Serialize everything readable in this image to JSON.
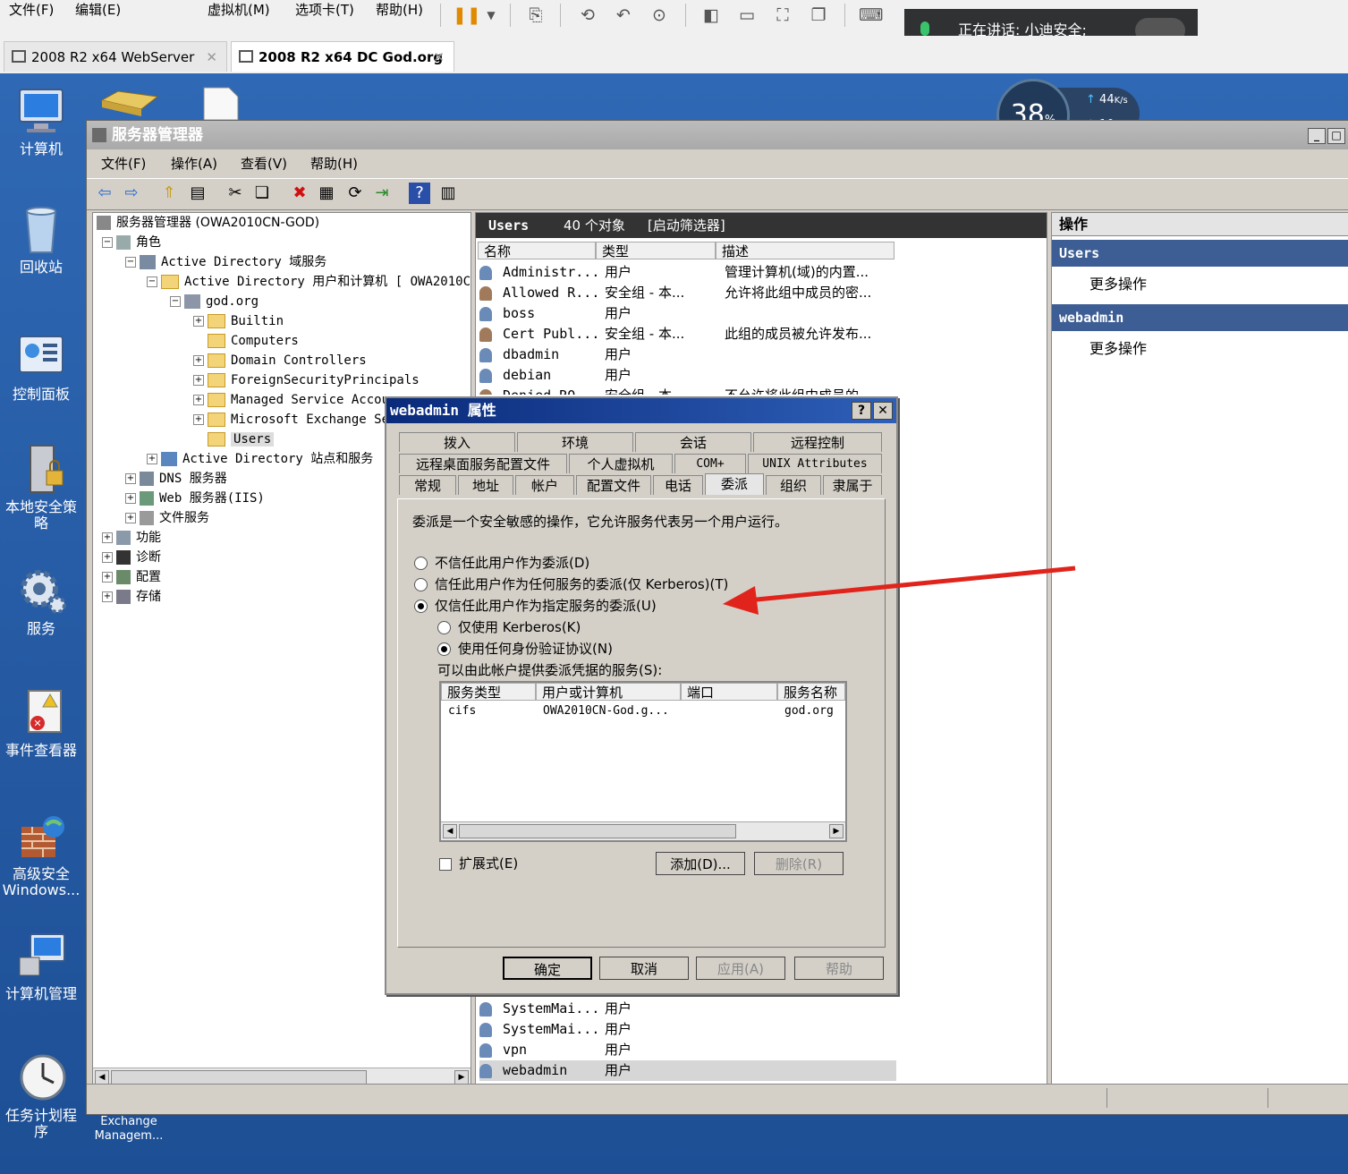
{
  "host": {
    "menus": [
      "文件(F)",
      "编辑(E)",
      "虚拟机(M)",
      "选项卡(T)",
      "帮助(H)"
    ],
    "tabs": [
      {
        "label": "2008 R2 x64 WebServer",
        "active": false
      },
      {
        "label": "2008 R2 x64 DC God.org",
        "active": true
      }
    ],
    "recording_text": "正在讲话: 小迪安全;"
  },
  "desktop": {
    "icons": [
      "计算机",
      "回收站",
      "控制面板",
      "本地安全策略",
      "服务",
      "事件查看器",
      "高级安全 Windows...",
      "计算机管理",
      "任务计划程序",
      "Exchange Managem..."
    ],
    "speed": {
      "percent": "38",
      "percent_unit": "%",
      "up": "44",
      "down": "10",
      "unit": "K/s"
    }
  },
  "server_manager": {
    "title": "服务器管理器",
    "menus": [
      "文件(F)",
      "操作(A)",
      "查看(V)",
      "帮助(H)"
    ],
    "tree": [
      {
        "label": "服务器管理器 (OWA2010CN-GOD)"
      },
      {
        "label": "角色"
      },
      {
        "label": "Active Directory 域服务"
      },
      {
        "label": "Active Directory 用户和计算机 [ OWA2010C"
      },
      {
        "label": "god.org"
      },
      {
        "label": "Builtin"
      },
      {
        "label": "Computers"
      },
      {
        "label": "Domain Controllers"
      },
      {
        "label": "ForeignSecurityPrincipals"
      },
      {
        "label": "Managed Service Accou"
      },
      {
        "label": "Microsoft Exchange Se"
      },
      {
        "label": "Users"
      },
      {
        "label": "Active Directory 站点和服务"
      },
      {
        "label": "DNS 服务器"
      },
      {
        "label": "Web 服务器(IIS)"
      },
      {
        "label": "文件服务"
      },
      {
        "label": "功能"
      },
      {
        "label": "诊断"
      },
      {
        "label": "配置"
      },
      {
        "label": "存储"
      }
    ],
    "list": {
      "header_title": "Users",
      "header_count": "40 个对象",
      "header_filter": "[启动筛选器]",
      "columns": [
        "名称",
        "类型",
        "描述"
      ],
      "rows": [
        {
          "name": "Administr...",
          "type": "用户",
          "desc": "管理计算机(域)的内置..."
        },
        {
          "name": "Allowed R...",
          "type": "安全组 - 本...",
          "desc": "允许将此组中成员的密..."
        },
        {
          "name": "boss",
          "type": "用户",
          "desc": ""
        },
        {
          "name": "Cert Publ...",
          "type": "安全组 - 本...",
          "desc": "此组的成员被允许发布..."
        },
        {
          "name": "dbadmin",
          "type": "用户",
          "desc": ""
        },
        {
          "name": "debian",
          "type": "用户",
          "desc": ""
        },
        {
          "name": "Denied RO...",
          "type": "安全组 - 本...",
          "desc": "不允许将此组中成员的..."
        },
        {
          "name": "SystemMai...",
          "type": "用户",
          "desc": ""
        },
        {
          "name": "SystemMai...",
          "type": "用户",
          "desc": ""
        },
        {
          "name": "vpn",
          "type": "用户",
          "desc": ""
        },
        {
          "name": "webadmin",
          "type": "用户",
          "desc": ""
        }
      ]
    },
    "actions": {
      "title": "操作",
      "sections": [
        {
          "header": "Users",
          "item": "更多操作"
        },
        {
          "header": "webadmin",
          "item": "更多操作"
        }
      ]
    }
  },
  "dialog": {
    "title": "webadmin 属性",
    "tabs_row1": [
      "拨入",
      "环境",
      "会话",
      "远程控制"
    ],
    "tabs_row2": [
      "远程桌面服务配置文件",
      "个人虚拟机",
      "COM+",
      "UNIX Attributes"
    ],
    "tabs_row3": [
      "常规",
      "地址",
      "帐户",
      "配置文件",
      "电话",
      "委派",
      "组织",
      "隶属于"
    ],
    "active_tab": "委派",
    "intro": "委派是一个安全敏感的操作，它允许服务代表另一个用户运行。",
    "options": [
      {
        "label": "不信任此用户作为委派(D)",
        "checked": false
      },
      {
        "label": "信任此用户作为任何服务的委派(仅 Kerberos)(T)",
        "checked": false
      },
      {
        "label": "仅信任此用户作为指定服务的委派(U)",
        "checked": true
      }
    ],
    "sub_options": [
      {
        "label": "仅使用 Kerberos(K)",
        "checked": false
      },
      {
        "label": "使用任何身份验证协议(N)",
        "checked": true
      }
    ],
    "services_label": "可以由此帐户提供委派凭据的服务(S):",
    "services_columns": [
      "服务类型",
      "用户或计算机",
      "端口",
      "服务名称"
    ],
    "services": [
      {
        "type": "cifs",
        "host": "OWA2010CN-God.g...",
        "port": "",
        "name": "god.org"
      }
    ],
    "expanded_label": "扩展式(E)",
    "add_button": "添加(D)...",
    "remove_button": "删除(R)",
    "ok": "确定",
    "cancel": "取消",
    "apply": "应用(A)",
    "help": "帮助"
  },
  "annotation_color": "#e0241c"
}
